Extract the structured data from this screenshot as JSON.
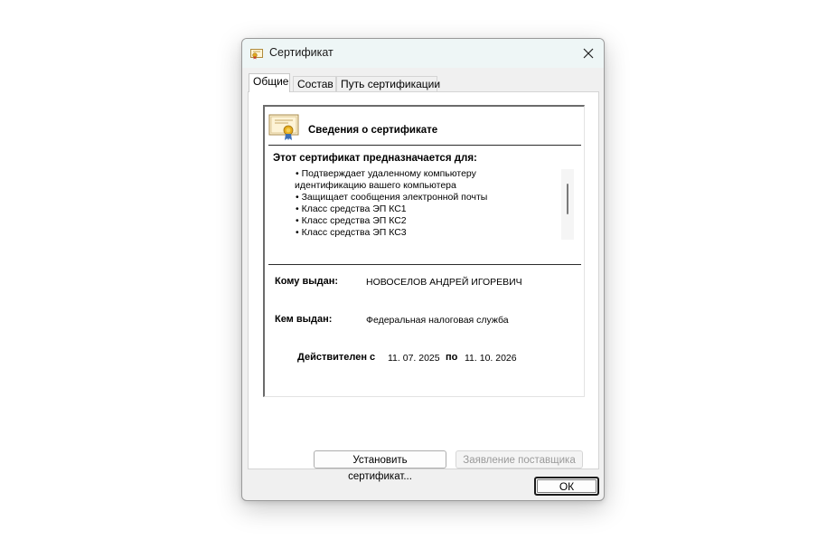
{
  "window": {
    "title": "Сертификат",
    "icon": "certificate-icon",
    "close_icon": "close-icon"
  },
  "tabs": [
    {
      "label": "Общие",
      "active": true
    },
    {
      "label": "Состав",
      "active": false
    },
    {
      "label": "Путь сертификации",
      "active": false
    }
  ],
  "info": {
    "heading": "Сведения о сертификате",
    "purpose_title": "Этот сертификат предназначается для:",
    "purposes": [
      "• Подтверждает удаленному компьютеру",
      "идентификацию вашего компьютера",
      "• Защищает сообщения электронной почты",
      "• Класс средства ЭП КС1",
      "• Класс средства ЭП КС2",
      "• Класс средства ЭП КС3"
    ],
    "issued_to_label": "Кому выдан:",
    "issued_to_value": "НОВОСЕЛОВ АНДРЕЙ ИГОРЕВИЧ",
    "issued_by_label": "Кем выдан:",
    "issued_by_value": "Федеральная налоговая служба",
    "valid_from_label": "Действителен с",
    "valid_from_value": "11. 07. 2025",
    "valid_to_label": "по",
    "valid_to_value": "11. 10. 2026"
  },
  "buttons": {
    "install": "Установить сертификат...",
    "vendor": "Заявление поставщика",
    "ok": "ОК"
  },
  "colors": {
    "titlebar": "#eef6f6",
    "dialog_bg": "#f0f0f0",
    "disabled_text": "#9a9a9a"
  }
}
